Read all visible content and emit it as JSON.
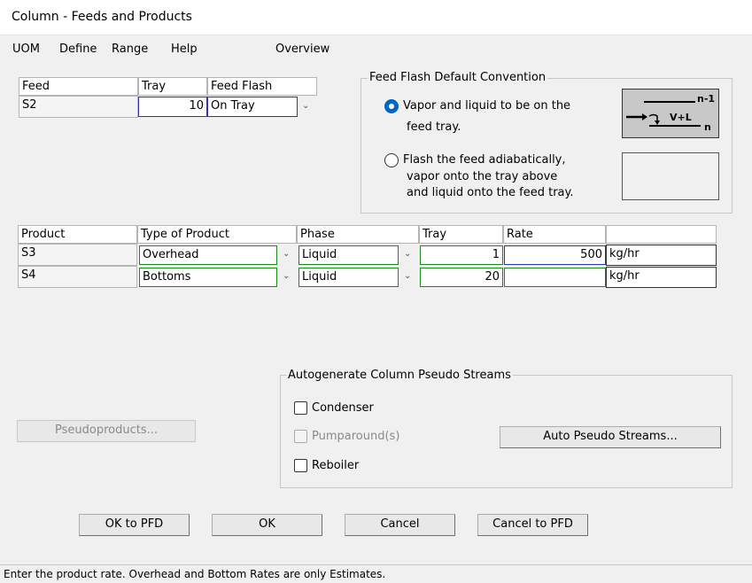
{
  "window": {
    "title": "Column - Feeds and Products"
  },
  "menu": {
    "uom": "UOM",
    "define": "Define",
    "range": "Range",
    "help": "Help",
    "overview": "Overview"
  },
  "feed_grid": {
    "headers": {
      "feed": "Feed",
      "tray": "Tray",
      "flash": "Feed Flash"
    },
    "rows": [
      {
        "name": "S2",
        "tray": "10",
        "flash": "On Tray"
      }
    ]
  },
  "flash_convention": {
    "title": "Feed Flash Default Convention",
    "option1": {
      "line1": "Vapor and liquid to be on the",
      "line2": "feed tray.",
      "selected": true
    },
    "option2": {
      "line1": "Flash the feed adiabatically,",
      "line2": "vapor onto the tray above",
      "line3": "and liquid onto the feed tray.",
      "selected": false
    },
    "diagram": {
      "top_label": "n-1",
      "mid_label": "V+L",
      "bottom_label": "n"
    }
  },
  "product_grid": {
    "headers": {
      "product": "Product",
      "type": "Type of Product",
      "phase": "Phase",
      "tray": "Tray",
      "rate": "Rate",
      "units": ""
    },
    "rows": [
      {
        "name": "S3",
        "type": "Overhead",
        "phase": "Liquid",
        "tray": "1",
        "rate": "500",
        "units": "kg/hr"
      },
      {
        "name": "S4",
        "type": "Bottoms",
        "phase": "Liquid",
        "tray": "20",
        "rate": "",
        "units": "kg/hr"
      }
    ]
  },
  "pseudo": {
    "title": "Autogenerate Column Pseudo Streams",
    "condenser": {
      "label": "Condenser",
      "checked": false
    },
    "pumparound": {
      "label": "Pumparound(s)",
      "checked": false,
      "enabled": false
    },
    "reboiler": {
      "label": "Reboiler",
      "checked": false
    },
    "auto_button": "Auto Pseudo Streams..."
  },
  "pseudoproducts_button": "Pseudoproducts...",
  "buttons": {
    "ok_pfd": "OK to PFD",
    "ok": "OK",
    "cancel": "Cancel",
    "cancel_pfd": "Cancel to PFD"
  },
  "status": "Enter the product rate. Overhead and Bottom Rates are only Estimates.",
  "colors": {
    "accent": "#0067c0",
    "input_border_green": "#1a8a1a",
    "input_border_blue": "#3030c8"
  },
  "icons": {
    "chevron": "chevron-down-icon",
    "radio": "radio-icon",
    "checkbox": "checkbox-icon"
  }
}
